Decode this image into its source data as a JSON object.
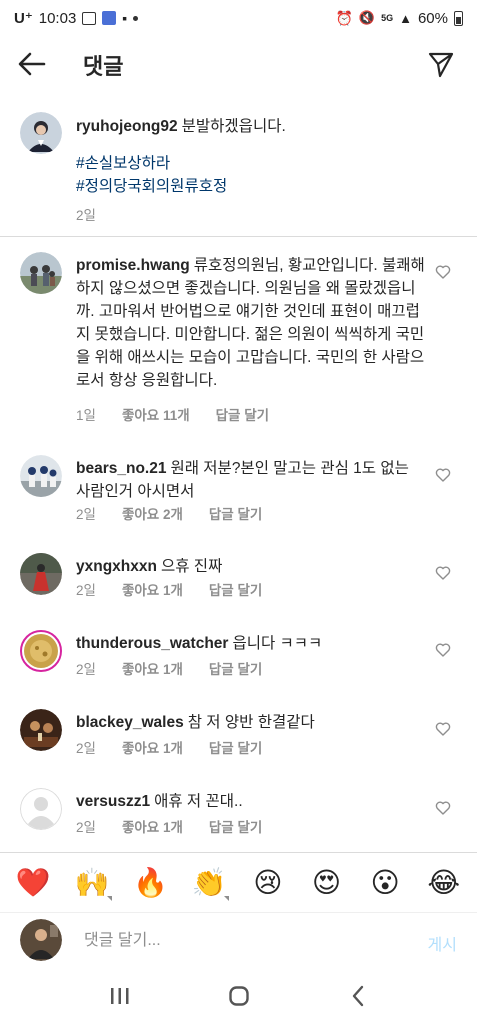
{
  "status_bar": {
    "carrier": "U⁺",
    "time": "10:03",
    "network": "5G",
    "battery": "60%"
  },
  "header": {
    "title": "댓글"
  },
  "caption": {
    "username": "ryuhojeong92",
    "text": "분발하겠읍니다.",
    "hashtags": [
      "#손실보상하라",
      "#정의당국회의원류호정"
    ],
    "time": "2일"
  },
  "comments": [
    {
      "username": "promise.hwang",
      "text": "류호정의원님, 황교안입니다. 불쾌해하지 않으셨으면 좋겠습니다. 의원님을 왜 몰랐겠읍니까. 고마워서 반어법으로 얘기한 것인데 표현이 매끄럽지 못했습니다. 미안합니다. 젊은 의원이 씩씩하게 국민을 위해 애쓰시는 모습이 고맙습니다. 국민의 한 사람으로서 항상 응원합니다.",
      "time": "1일",
      "likes": "좋아요 11개",
      "reply": "답글 달기"
    },
    {
      "username": "bears_no.21",
      "text": "원래 저분?본인 말고는 관심 1도 없는 사람인거 아시면서",
      "time": "2일",
      "likes": "좋아요 2개",
      "reply": "답글 달기"
    },
    {
      "username": "yxngxhxxn",
      "text": "으휴 진짜",
      "time": "2일",
      "likes": "좋아요 1개",
      "reply": "답글 달기"
    },
    {
      "username": "thunderous_watcher",
      "text": "읍니다 ㅋㅋㅋ",
      "time": "2일",
      "likes": "좋아요 1개",
      "reply": "답글 달기"
    },
    {
      "username": "blackey_wales",
      "text": "참 저 양반 한결같다",
      "time": "2일",
      "likes": "좋아요 1개",
      "reply": "답글 달기"
    },
    {
      "username": "versuszz1",
      "text": "애휴 저 꼰대..",
      "time": "2일",
      "likes": "좋아요 1개",
      "reply": "답글 달기"
    }
  ],
  "emojis": [
    {
      "glyph": "❤️",
      "icon": "heart-emoji"
    },
    {
      "glyph": "🙌",
      "icon": "raised-hands-emoji"
    },
    {
      "glyph": "🔥",
      "icon": "fire-emoji"
    },
    {
      "glyph": "👏",
      "icon": "clapping-hands-emoji"
    },
    {
      "glyph": "😢",
      "icon": "crying-face-emoji"
    },
    {
      "glyph": "😍",
      "icon": "heart-eyes-emoji"
    },
    {
      "glyph": "😮",
      "icon": "surprised-face-emoji"
    },
    {
      "glyph": "😂",
      "icon": "tears-of-joy-emoji"
    }
  ],
  "input": {
    "placeholder": "댓글 달기...",
    "post_label": "게시"
  },
  "colors": {
    "hashtag": "#00376b",
    "meta": "#8e8e8e",
    "post_disabled": "#b2dffc"
  }
}
